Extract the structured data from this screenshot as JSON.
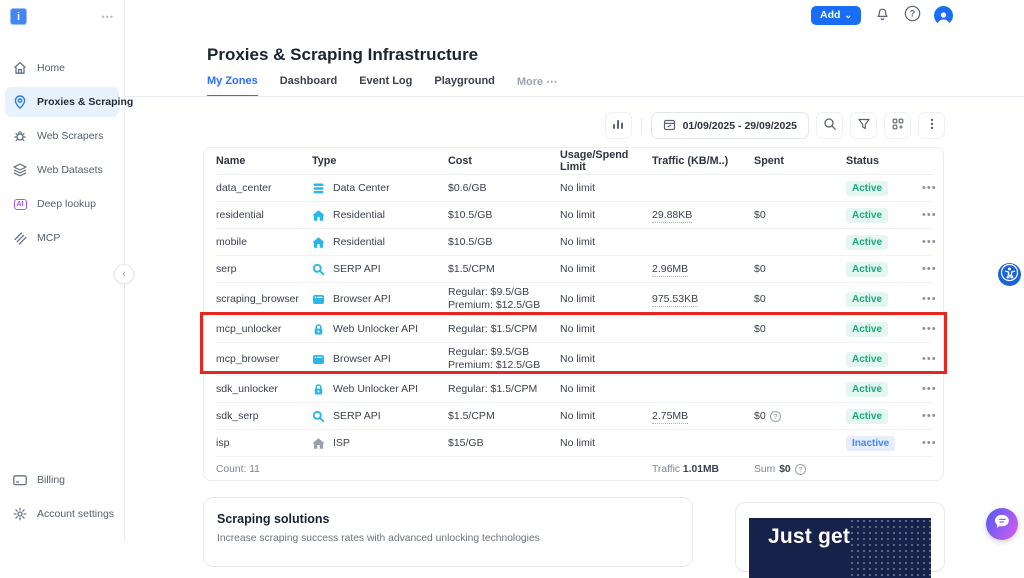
{
  "glyphs": {
    "dots_h": "•••",
    "chevron_left": "‹",
    "chevron_down": "⌄",
    "ellipsis": "•••",
    "question": "?",
    "logo_letter": "i"
  },
  "colors": {
    "accent": "#1a6ef5",
    "tab_active": "#2970ff",
    "icon_cyan": "#29b6e8",
    "icon_gray": "#98a1ad",
    "sidebar_icon": "#64748b",
    "pin_blue": "#2b7de9",
    "active_badge": "#1ba97f",
    "inactive_badge": "#4187f5",
    "highlight_red": "#e8251f",
    "banner_navy": "#16224a"
  },
  "sidebar": {
    "items": [
      {
        "label": "Home",
        "icon": "home",
        "active": false
      },
      {
        "label": "Proxies & Scraping",
        "icon": "pin",
        "active": true
      },
      {
        "label": "Web Scrapers",
        "icon": "bug",
        "active": false
      },
      {
        "label": "Web Datasets",
        "icon": "layers",
        "active": false
      },
      {
        "label": "Deep lookup",
        "icon": "ai",
        "active": false
      },
      {
        "label": "MCP",
        "icon": "mcp",
        "active": false
      }
    ],
    "bottom_items": [
      {
        "label": "Billing",
        "icon": "card",
        "active": false
      },
      {
        "label": "Account settings",
        "icon": "gear",
        "active": false
      }
    ]
  },
  "topbar": {
    "add_label": "Add"
  },
  "page": {
    "title": "Proxies & Scraping Infrastructure",
    "tabs": [
      {
        "label": "My Zones",
        "active": true,
        "muted": false
      },
      {
        "label": "Dashboard",
        "active": false,
        "muted": false
      },
      {
        "label": "Event Log",
        "active": false,
        "muted": false
      },
      {
        "label": "Playground",
        "active": false,
        "muted": false
      },
      {
        "label": "More ⋯",
        "active": false,
        "muted": true
      }
    ]
  },
  "toolbar": {
    "date_range": "01/09/2025 - 29/09/2025"
  },
  "table": {
    "columns": [
      "Name",
      "Type",
      "Cost",
      "Usage/Spend Limit",
      "Traffic (KB/M..)",
      "Spent",
      "Status"
    ],
    "rows": [
      {
        "name": "data_center",
        "icon": "datacenter",
        "type": "Data Center",
        "cost": [
          "$0.6/GB"
        ],
        "limit": "No limit",
        "traffic": "",
        "spent": "",
        "spent_help": false,
        "status": "Active",
        "tall": false,
        "highlight": false
      },
      {
        "name": "residential",
        "icon": "house",
        "type": "Residential",
        "cost": [
          "$10.5/GB"
        ],
        "limit": "No limit",
        "traffic": "29.88KB",
        "spent": "$0",
        "spent_help": false,
        "status": "Active",
        "tall": false,
        "highlight": false
      },
      {
        "name": "mobile",
        "icon": "house",
        "type": "Residential",
        "cost": [
          "$10.5/GB"
        ],
        "limit": "No limit",
        "traffic": "",
        "spent": "",
        "spent_help": false,
        "status": "Active",
        "tall": false,
        "highlight": false
      },
      {
        "name": "serp",
        "icon": "serp",
        "type": "SERP API",
        "cost": [
          "$1.5/CPM"
        ],
        "limit": "No limit",
        "traffic": "2.96MB",
        "spent": "$0",
        "spent_help": false,
        "status": "Active",
        "tall": false,
        "highlight": false
      },
      {
        "name": "scraping_browser",
        "icon": "browser",
        "type": "Browser API",
        "cost": [
          "Regular: $9.5/GB",
          "Premium: $12.5/GB"
        ],
        "limit": "No limit",
        "traffic": "975.53KB",
        "spent": "$0",
        "spent_help": false,
        "status": "Active",
        "tall": true,
        "highlight": false
      },
      {
        "name": "mcp_unlocker",
        "icon": "lock",
        "type": "Web Unlocker API",
        "cost": [
          "Regular: $1.5/CPM"
        ],
        "limit": "No limit",
        "traffic": "",
        "spent": "$0",
        "spent_help": false,
        "status": "Active",
        "tall": false,
        "highlight": true
      },
      {
        "name": "mcp_browser",
        "icon": "browser",
        "type": "Browser API",
        "cost": [
          "Regular: $9.5/GB",
          "Premium: $12.5/GB"
        ],
        "limit": "No limit",
        "traffic": "",
        "spent": "",
        "spent_help": false,
        "status": "Active",
        "tall": true,
        "highlight": true
      },
      {
        "name": "sdk_unlocker",
        "icon": "lock",
        "type": "Web Unlocker API",
        "cost": [
          "Regular: $1.5/CPM"
        ],
        "limit": "No limit",
        "traffic": "",
        "spent": "",
        "spent_help": false,
        "status": "Active",
        "tall": false,
        "highlight": false
      },
      {
        "name": "sdk_serp",
        "icon": "serp",
        "type": "SERP API",
        "cost": [
          "$1.5/CPM"
        ],
        "limit": "No limit",
        "traffic": "2.75MB",
        "spent": "$0",
        "spent_help": true,
        "status": "Active",
        "tall": false,
        "highlight": false
      },
      {
        "name": "isp",
        "icon": "house_gray",
        "type": "ISP",
        "cost": [
          "$15/GB"
        ],
        "limit": "No limit",
        "traffic": "",
        "spent": "",
        "spent_help": false,
        "status": "Inactive",
        "tall": false,
        "highlight": false
      }
    ],
    "footer": {
      "count_label": "Count:",
      "count": "11",
      "traffic_label": "Traffic",
      "traffic": "1.01MB",
      "sum_label": "Sum",
      "sum": "$0"
    }
  },
  "cards": {
    "solutions": {
      "title": "Scraping solutions",
      "subtitle": "Increase scraping success rates with advanced unlocking technologies"
    },
    "banner": {
      "text": "Just get"
    }
  }
}
